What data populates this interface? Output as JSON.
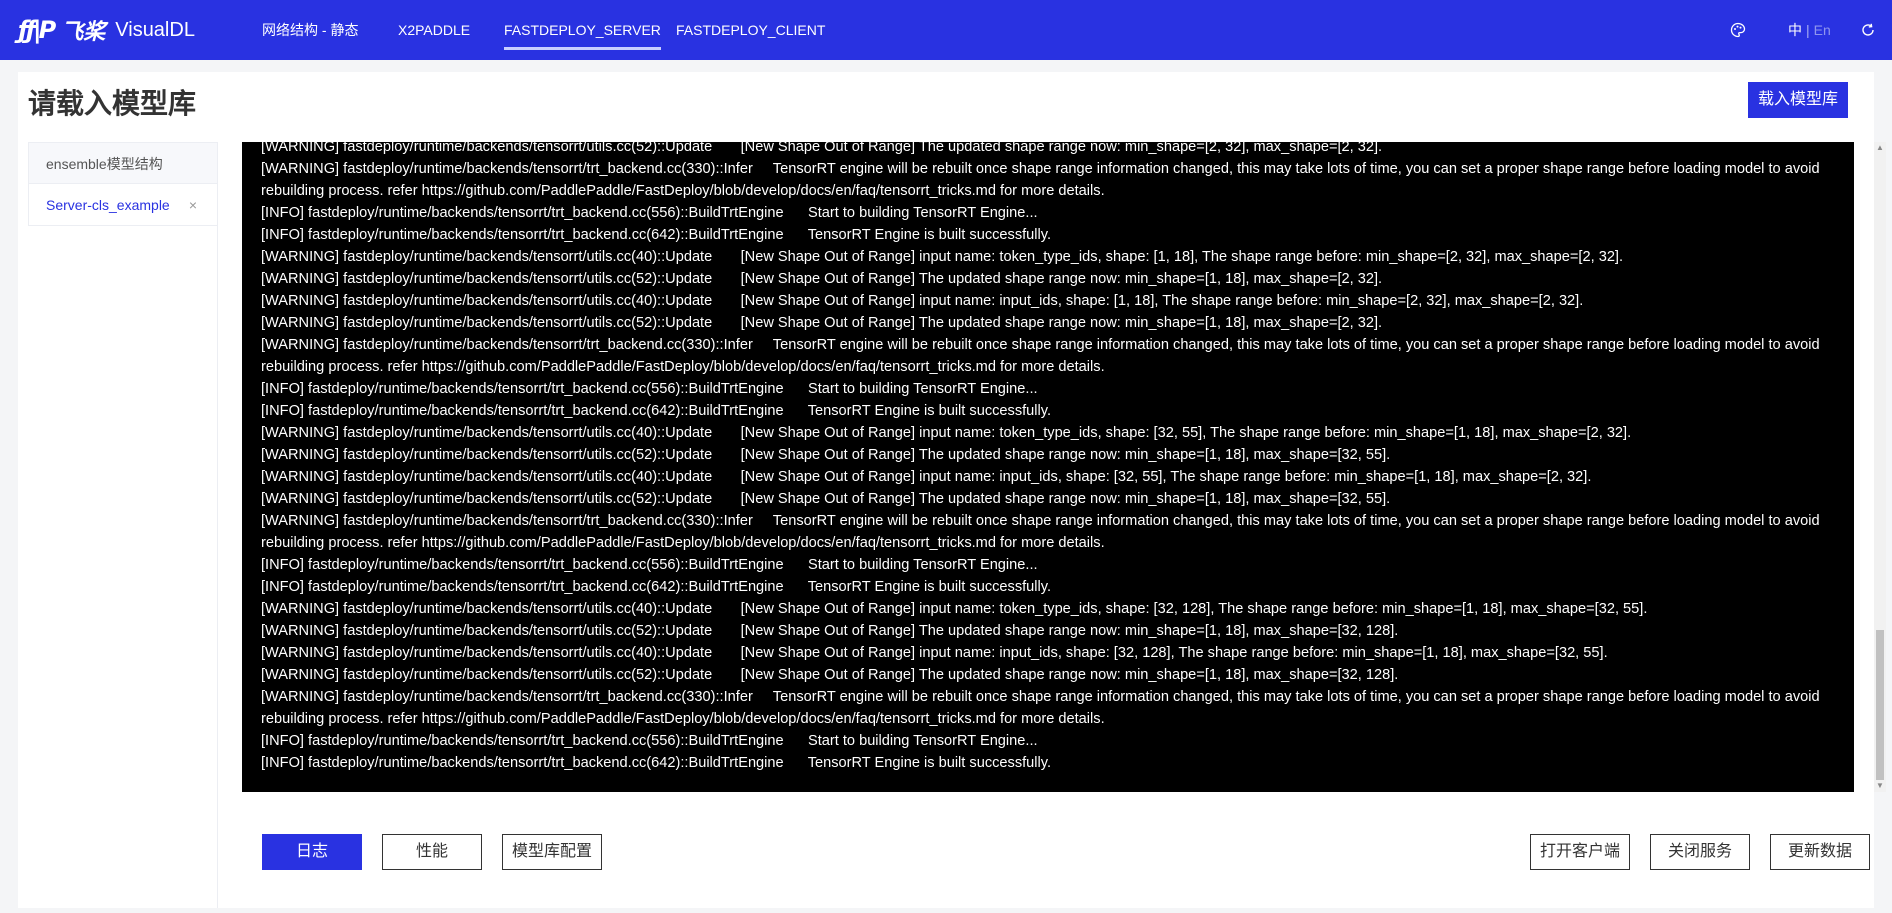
{
  "brand": {
    "mark": "ƒƒ|P",
    "cn": "飞桨",
    "app": "VisualDL"
  },
  "nav": [
    {
      "label": "网络结构 - 静态"
    },
    {
      "label": "X2PADDLE"
    },
    {
      "label": "FASTDEPLOY_SERVER"
    },
    {
      "label": "FASTDEPLOY_CLIENT"
    }
  ],
  "active_nav": "FASTDEPLOY_SERVER",
  "lang": {
    "zh": "中",
    "sep": "|",
    "en": "En"
  },
  "page": {
    "title": "请载入模型库",
    "load_button": "载入模型库"
  },
  "tabs": [
    {
      "label": "ensemble模型结构"
    },
    {
      "label": "Server-cls_example",
      "close": "×"
    }
  ],
  "log_lines": [
    "[WARNING] fastdeploy/runtime/backends/tensorrt/utils.cc(52)::Update       [New Shape Out of Range] The updated shape range now: min_shape=[2, 32], max_shape=[2, 32].",
    "[WARNING] fastdeploy/runtime/backends/tensorrt/trt_backend.cc(330)::Infer     TensorRT engine will be rebuilt once shape range information changed, this may take lots of time, you can set a proper shape range before loading model to avoid rebuilding process. refer https://github.com/PaddlePaddle/FastDeploy/blob/develop/docs/en/faq/tensorrt_tricks.md for more details.",
    "[INFO] fastdeploy/runtime/backends/tensorrt/trt_backend.cc(556)::BuildTrtEngine      Start to building TensorRT Engine...",
    "[INFO] fastdeploy/runtime/backends/tensorrt/trt_backend.cc(642)::BuildTrtEngine      TensorRT Engine is built successfully.",
    "[WARNING] fastdeploy/runtime/backends/tensorrt/utils.cc(40)::Update       [New Shape Out of Range] input name: token_type_ids, shape: [1, 18], The shape range before: min_shape=[2, 32], max_shape=[2, 32].",
    "[WARNING] fastdeploy/runtime/backends/tensorrt/utils.cc(52)::Update       [New Shape Out of Range] The updated shape range now: min_shape=[1, 18], max_shape=[2, 32].",
    "[WARNING] fastdeploy/runtime/backends/tensorrt/utils.cc(40)::Update       [New Shape Out of Range] input name: input_ids, shape: [1, 18], The shape range before: min_shape=[2, 32], max_shape=[2, 32].",
    "[WARNING] fastdeploy/runtime/backends/tensorrt/utils.cc(52)::Update       [New Shape Out of Range] The updated shape range now: min_shape=[1, 18], max_shape=[2, 32].",
    "[WARNING] fastdeploy/runtime/backends/tensorrt/trt_backend.cc(330)::Infer     TensorRT engine will be rebuilt once shape range information changed, this may take lots of time, you can set a proper shape range before loading model to avoid rebuilding process. refer https://github.com/PaddlePaddle/FastDeploy/blob/develop/docs/en/faq/tensorrt_tricks.md for more details.",
    "[INFO] fastdeploy/runtime/backends/tensorrt/trt_backend.cc(556)::BuildTrtEngine      Start to building TensorRT Engine...",
    "[INFO] fastdeploy/runtime/backends/tensorrt/trt_backend.cc(642)::BuildTrtEngine      TensorRT Engine is built successfully.",
    "[WARNING] fastdeploy/runtime/backends/tensorrt/utils.cc(40)::Update       [New Shape Out of Range] input name: token_type_ids, shape: [32, 55], The shape range before: min_shape=[1, 18], max_shape=[2, 32].",
    "[WARNING] fastdeploy/runtime/backends/tensorrt/utils.cc(52)::Update       [New Shape Out of Range] The updated shape range now: min_shape=[1, 18], max_shape=[32, 55].",
    "[WARNING] fastdeploy/runtime/backends/tensorrt/utils.cc(40)::Update       [New Shape Out of Range] input name: input_ids, shape: [32, 55], The shape range before: min_shape=[1, 18], max_shape=[2, 32].",
    "[WARNING] fastdeploy/runtime/backends/tensorrt/utils.cc(52)::Update       [New Shape Out of Range] The updated shape range now: min_shape=[1, 18], max_shape=[32, 55].",
    "[WARNING] fastdeploy/runtime/backends/tensorrt/trt_backend.cc(330)::Infer     TensorRT engine will be rebuilt once shape range information changed, this may take lots of time, you can set a proper shape range before loading model to avoid rebuilding process. refer https://github.com/PaddlePaddle/FastDeploy/blob/develop/docs/en/faq/tensorrt_tricks.md for more details.",
    "[INFO] fastdeploy/runtime/backends/tensorrt/trt_backend.cc(556)::BuildTrtEngine      Start to building TensorRT Engine...",
    "[INFO] fastdeploy/runtime/backends/tensorrt/trt_backend.cc(642)::BuildTrtEngine      TensorRT Engine is built successfully.",
    "[WARNING] fastdeploy/runtime/backends/tensorrt/utils.cc(40)::Update       [New Shape Out of Range] input name: token_type_ids, shape: [32, 128], The shape range before: min_shape=[1, 18], max_shape=[32, 55].",
    "[WARNING] fastdeploy/runtime/backends/tensorrt/utils.cc(52)::Update       [New Shape Out of Range] The updated shape range now: min_shape=[1, 18], max_shape=[32, 128].",
    "[WARNING] fastdeploy/runtime/backends/tensorrt/utils.cc(40)::Update       [New Shape Out of Range] input name: input_ids, shape: [32, 128], The shape range before: min_shape=[1, 18], max_shape=[32, 55].",
    "[WARNING] fastdeploy/runtime/backends/tensorrt/utils.cc(52)::Update       [New Shape Out of Range] The updated shape range now: min_shape=[1, 18], max_shape=[32, 128].",
    "[WARNING] fastdeploy/runtime/backends/tensorrt/trt_backend.cc(330)::Infer     TensorRT engine will be rebuilt once shape range information changed, this may take lots of time, you can set a proper shape range before loading model to avoid rebuilding process. refer https://github.com/PaddlePaddle/FastDeploy/blob/develop/docs/en/faq/tensorrt_tricks.md for more details.",
    "[INFO] fastdeploy/runtime/backends/tensorrt/trt_backend.cc(556)::BuildTrtEngine      Start to building TensorRT Engine...",
    "[INFO] fastdeploy/runtime/backends/tensorrt/trt_backend.cc(642)::BuildTrtEngine      TensorRT Engine is built successfully."
  ],
  "bottom_left": [
    {
      "label": "日志"
    },
    {
      "label": "性能"
    },
    {
      "label": "模型库配置"
    }
  ],
  "bottom_right": [
    {
      "label": "打开客户端"
    },
    {
      "label": "关闭服务"
    },
    {
      "label": "更新数据"
    }
  ],
  "icons": {
    "theme": "palette-icon",
    "refresh": "refresh-icon",
    "close": "close-icon"
  },
  "colors": {
    "brand": "#2932e1",
    "log_bg": "#000000",
    "log_text": "#ffffff"
  }
}
